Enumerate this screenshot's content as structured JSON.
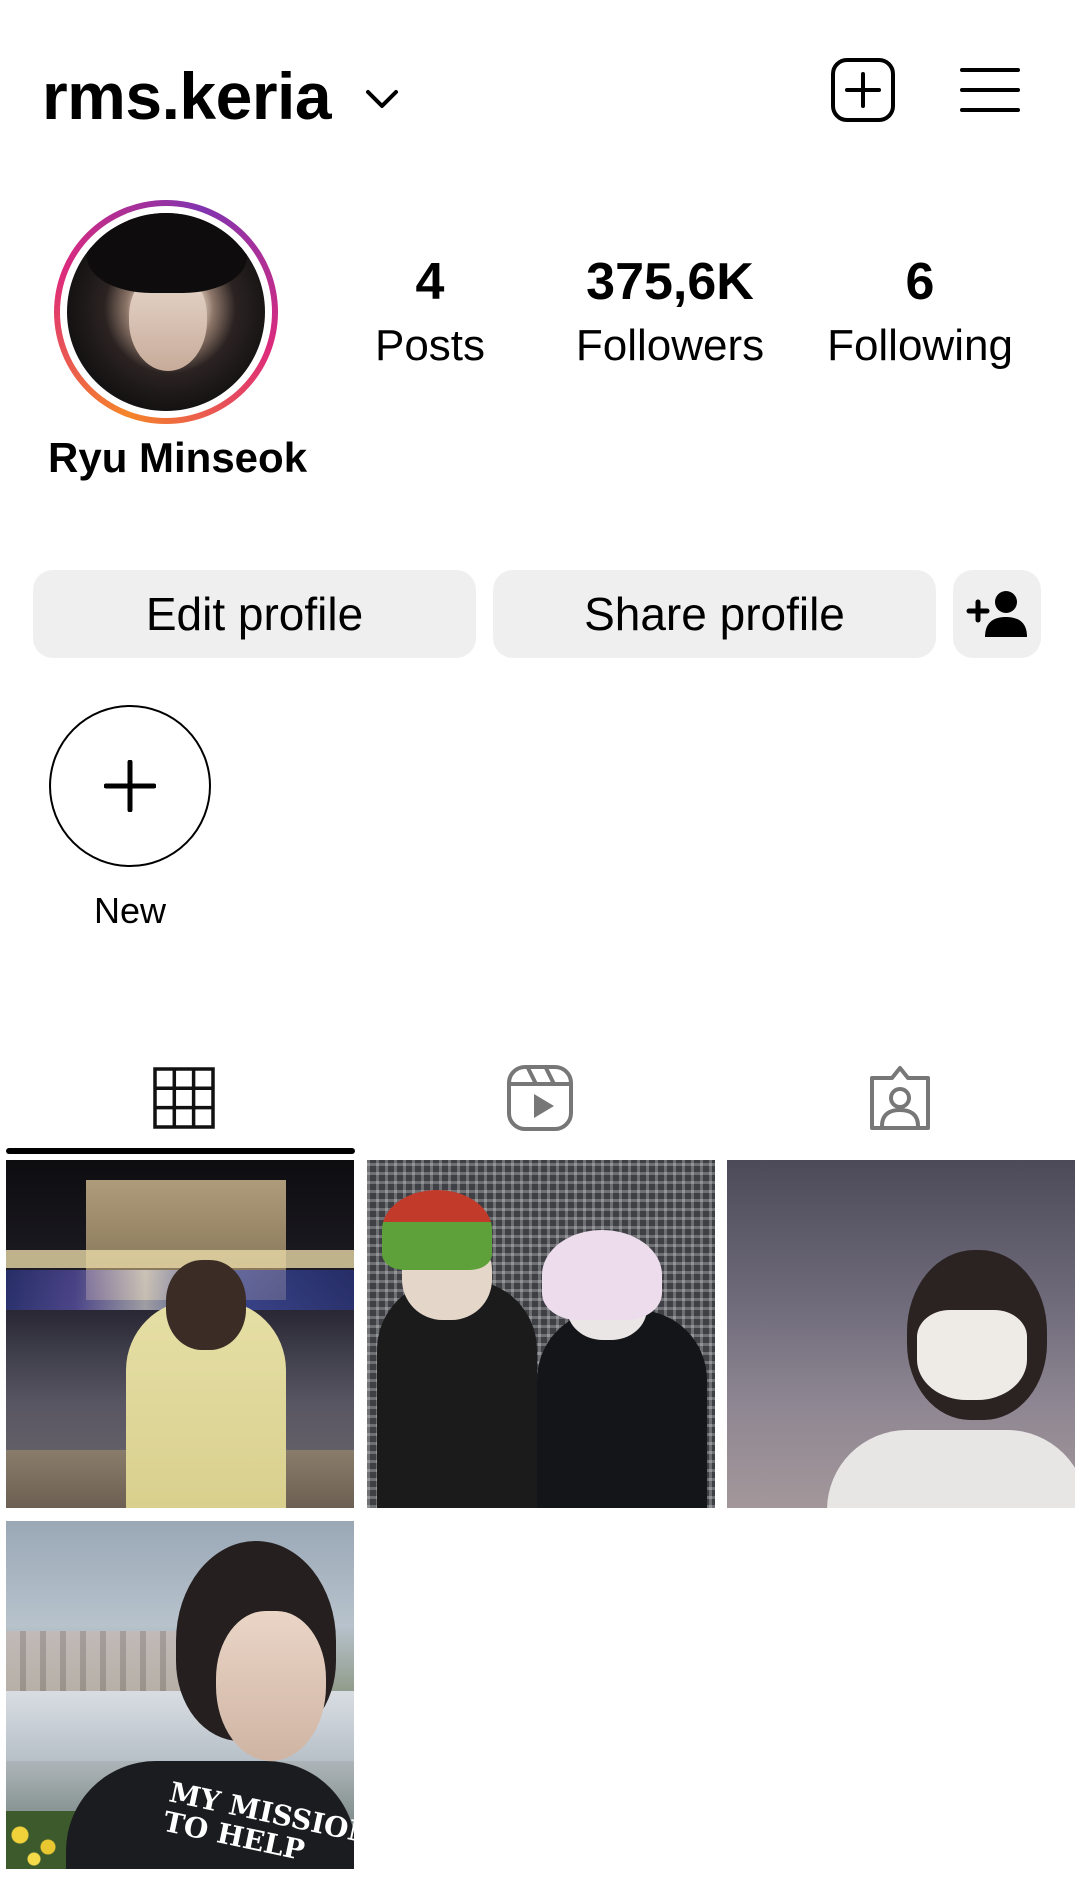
{
  "header": {
    "username": "rms.keria",
    "chevron_icon": "chevron-down-icon",
    "new_post_icon": "add-square-icon",
    "menu_icon": "hamburger-menu-icon"
  },
  "profile": {
    "display_name": "Ryu Minseok",
    "story_ring_colors": [
      "#f58529",
      "#dd2a7b",
      "#8134af"
    ],
    "stats": {
      "posts": {
        "value": "4",
        "label": "Posts"
      },
      "followers": {
        "value": "375,6K",
        "label": "Followers"
      },
      "following": {
        "value": "6",
        "label": "Following"
      }
    }
  },
  "actions": {
    "edit_label": "Edit profile",
    "share_label": "Share profile",
    "add_person_icon": "add-person-icon"
  },
  "highlights": [
    {
      "label": "New",
      "icon": "plus-icon"
    }
  ],
  "tabs": [
    {
      "icon": "grid-icon",
      "active": true
    },
    {
      "icon": "reels-icon",
      "active": false
    },
    {
      "icon": "tagged-icon",
      "active": false
    }
  ],
  "posts": [
    {
      "shirt_text": ""
    },
    {
      "shirt_text": ""
    },
    {
      "shirt_text": ""
    },
    {
      "shirt_text_line1": "MY MISSION IS",
      "shirt_text_line2": "TO HELP"
    }
  ]
}
